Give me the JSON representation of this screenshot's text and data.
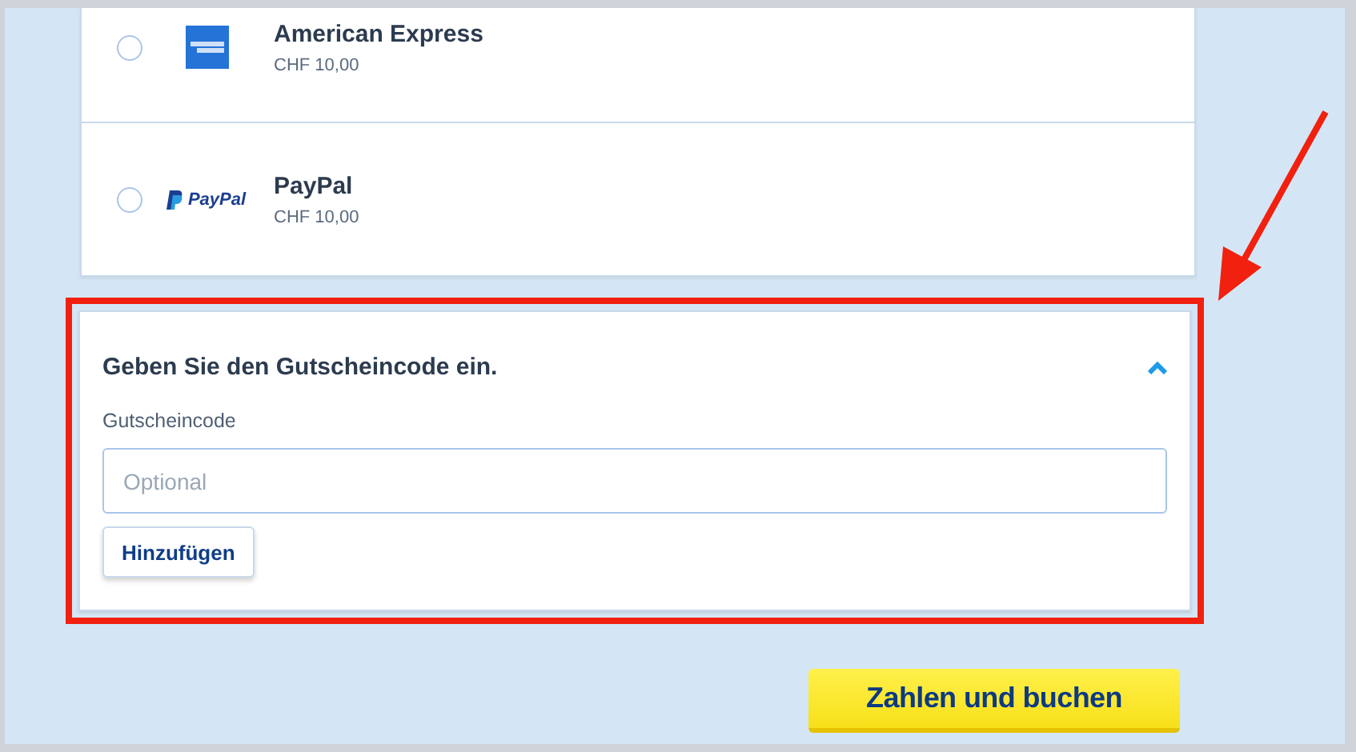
{
  "payment_methods": [
    {
      "kind": "amex",
      "name": "American Express",
      "price": "CHF 10,00",
      "selected": false
    },
    {
      "kind": "paypal",
      "logo_text": "PayPal",
      "name": "PayPal",
      "price": "CHF 10,00",
      "selected": false
    }
  ],
  "voucher": {
    "highlighted": true,
    "title": "Geben Sie den Gutscheincode ein.",
    "expanded": true,
    "field_label": "Gutscheincode",
    "placeholder": "Optional",
    "add_button": "Hinzufügen"
  },
  "pay_button": "Zahlen und buchen"
}
